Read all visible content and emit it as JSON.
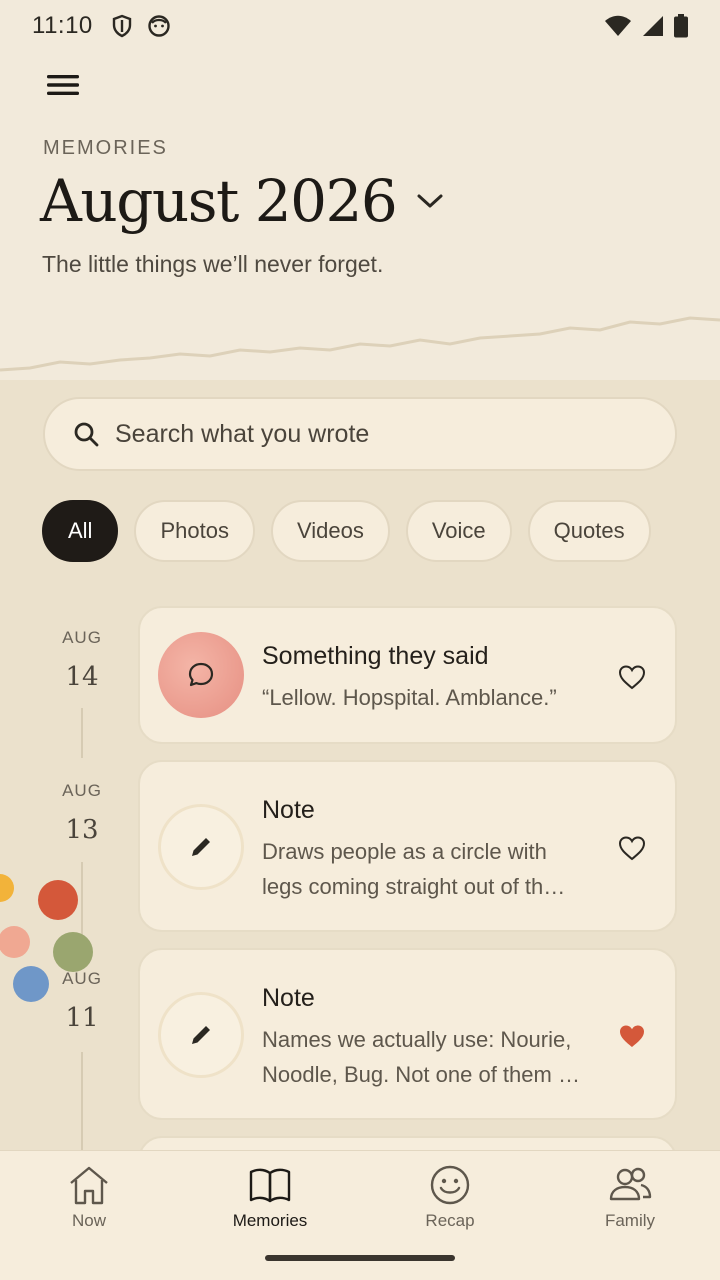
{
  "status_bar": {
    "time": "11:10",
    "icons_left": [
      "shield-icon",
      "face-icon"
    ],
    "icons_right": [
      "wifi-icon",
      "signal-icon",
      "battery-icon"
    ]
  },
  "header": {
    "overline": "MEMORIES",
    "title": "August 2026",
    "subtitle": "The little things we’ll never forget."
  },
  "search": {
    "placeholder": "Search what you wrote"
  },
  "filters": [
    {
      "label": "All",
      "active": true
    },
    {
      "label": "Photos",
      "active": false
    },
    {
      "label": "Videos",
      "active": false
    },
    {
      "label": "Voice",
      "active": false
    },
    {
      "label": "Quotes",
      "active": false
    }
  ],
  "entries": [
    {
      "month": "AUG",
      "day": "14",
      "title": "Something they said",
      "body": "“Lellow. Hopspital. Amblance.”",
      "icon": "speech-bubble-icon",
      "favorited": false
    },
    {
      "month": "AUG",
      "day": "13",
      "title": "Note",
      "body_line1": "Draws people as a circle with",
      "body_line2": "legs coming straight out of th…",
      "icon": "pencil-icon",
      "favorited": false
    },
    {
      "month": "AUG",
      "day": "11",
      "title": "Note",
      "body_line1": "Names we actually use: Nourie,",
      "body_line2": "Noodle, Bug. Not one of them …",
      "icon": "pencil-icon",
      "favorited": true
    }
  ],
  "bottom_nav": [
    {
      "label": "Now",
      "icon": "home-icon",
      "active": false
    },
    {
      "label": "Memories",
      "icon": "book-icon",
      "active": true
    },
    {
      "label": "Recap",
      "icon": "smile-icon",
      "active": false
    },
    {
      "label": "Family",
      "icon": "people-icon",
      "active": false
    }
  ],
  "colors": {
    "accent_dark": "#1f1b17",
    "favorite": "#d4583a",
    "background": "#ebe1cc",
    "card": "#f6eddc"
  }
}
